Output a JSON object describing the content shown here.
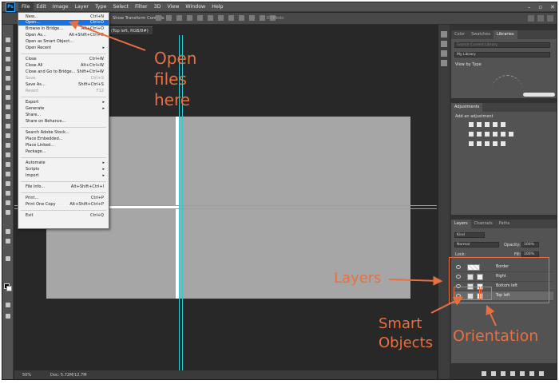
{
  "menubar": {
    "logo": "Ps",
    "items": [
      "File",
      "Edit",
      "Image",
      "Layer",
      "Type",
      "Select",
      "Filter",
      "3D",
      "View",
      "Window",
      "Help"
    ]
  },
  "optionsbar": {
    "transform_label": "Show Transform Controls",
    "mode_3d": "3D Mode:"
  },
  "doc_tab": "(Top left, RGB/8#)",
  "file_menu": [
    {
      "label": "New...",
      "shortcut": "Ctrl+N"
    },
    {
      "label": "Open...",
      "shortcut": "Ctrl+O",
      "highlight": true
    },
    {
      "label": "Browse in Bridge...",
      "shortcut": "Alt+Ctrl+O"
    },
    {
      "label": "Open As...",
      "shortcut": "Alt+Shift+Ctrl+O"
    },
    {
      "label": "Open as Smart Object...",
      "shortcut": ""
    },
    {
      "label": "Open Recent",
      "shortcut": "",
      "submenu": true
    },
    {
      "label": "Close",
      "shortcut": "Ctrl+W"
    },
    {
      "label": "Close All",
      "shortcut": "Alt+Ctrl+W"
    },
    {
      "label": "Close and Go to Bridge...",
      "shortcut": "Shift+Ctrl+W"
    },
    {
      "label": "Save",
      "shortcut": "Ctrl+S",
      "disabled": true
    },
    {
      "label": "Save As...",
      "shortcut": "Shift+Ctrl+S"
    },
    {
      "label": "Revert",
      "shortcut": "F12",
      "disabled": true
    },
    {
      "label": "Export",
      "shortcut": "",
      "submenu": true
    },
    {
      "label": "Generate",
      "shortcut": "",
      "submenu": true
    },
    {
      "label": "Share...",
      "shortcut": ""
    },
    {
      "label": "Share on Behance...",
      "shortcut": ""
    },
    {
      "label": "Search Adobe Stock...",
      "shortcut": ""
    },
    {
      "label": "Place Embedded...",
      "shortcut": ""
    },
    {
      "label": "Place Linked...",
      "shortcut": ""
    },
    {
      "label": "Package...",
      "shortcut": ""
    },
    {
      "label": "Automate",
      "shortcut": "",
      "submenu": true
    },
    {
      "label": "Scripts",
      "shortcut": "",
      "submenu": true
    },
    {
      "label": "Import",
      "shortcut": "",
      "submenu": true
    },
    {
      "label": "File Info...",
      "shortcut": "Alt+Shift+Ctrl+I"
    },
    {
      "label": "Print...",
      "shortcut": "Ctrl+P"
    },
    {
      "label": "Print One Copy",
      "shortcut": "Alt+Shift+Ctrl+P"
    },
    {
      "label": "Exit",
      "shortcut": "Ctrl+Q"
    }
  ],
  "status": {
    "zoom": "50%",
    "doc": "Doc: 5.72M/12.7M"
  },
  "libraries_panel": {
    "tabs": [
      "Color",
      "Swatches",
      "Libraries"
    ],
    "search_placeholder": "Search Current Library",
    "library_name": "My Library",
    "view_by": "View by Type"
  },
  "adjustments_panel": {
    "tab": "Adjustments",
    "add_label": "Add an adjustment"
  },
  "layers_panel": {
    "tabs": [
      "Layers",
      "Channels",
      "Paths"
    ],
    "kind": "Kind",
    "blend_mode": "Normal",
    "opacity_label": "Opacity:",
    "opacity": "100%",
    "lock_label": "Lock:",
    "fill_label": "Fill:",
    "fill": "100%",
    "layers": [
      "Border",
      "Right",
      "Bottom left",
      "Top left"
    ]
  },
  "annotations": {
    "open_files": [
      "Open",
      "files",
      "here"
    ],
    "layers": "Layers",
    "smart_objects": [
      "Smart",
      "Objects"
    ],
    "orientation": "Orientation",
    "color": "#e87040"
  }
}
